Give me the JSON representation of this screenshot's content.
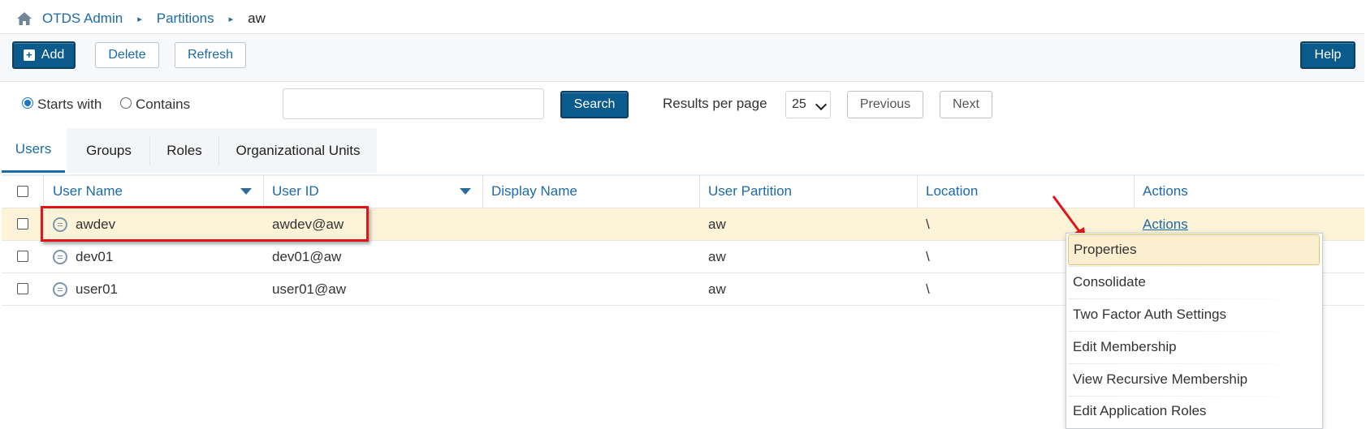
{
  "breadcrumb": {
    "items": [
      "OTDS Admin",
      "Partitions"
    ],
    "current": "aw",
    "separator": "▸"
  },
  "toolbar": {
    "add_label": "Add",
    "delete_label": "Delete",
    "refresh_label": "Refresh",
    "help_label": "Help"
  },
  "search": {
    "starts_with_label": "Starts with",
    "contains_label": "Contains",
    "selected_mode": "Starts with",
    "input_value": "",
    "search_label": "Search",
    "results_per_page_label": "Results per page",
    "results_per_page_value": "25",
    "previous_label": "Previous",
    "next_label": "Next"
  },
  "tabs": [
    {
      "label": "Users",
      "active": true
    },
    {
      "label": "Groups",
      "active": false
    },
    {
      "label": "Roles",
      "active": false
    },
    {
      "label": "Organizational Units",
      "active": false
    }
  ],
  "table": {
    "columns": [
      "User Name",
      "User ID",
      "Display Name",
      "User Partition",
      "Location",
      "Actions"
    ],
    "rows": [
      {
        "user_name": "awdev",
        "user_id": "awdev@aw",
        "display_name": "",
        "partition": "aw",
        "location": "\\",
        "actions": "Actions",
        "selected": true
      },
      {
        "user_name": "dev01",
        "user_id": "dev01@aw",
        "display_name": "",
        "partition": "aw",
        "location": "\\",
        "actions": "",
        "selected": false
      },
      {
        "user_name": "user01",
        "user_id": "user01@aw",
        "display_name": "",
        "partition": "aw",
        "location": "\\",
        "actions": "",
        "selected": false
      }
    ]
  },
  "actions_menu": {
    "items": [
      "Properties",
      "Consolidate",
      "Two Factor Auth Settings",
      "Edit Membership",
      "View Recursive Membership",
      "Edit Application Roles"
    ],
    "hovered": "Properties"
  },
  "colors": {
    "accent": "#1c6aa6",
    "primary_button": "#0a5a8c",
    "selected_row": "#fcf3d9",
    "annotation_red": "#e0151b"
  }
}
